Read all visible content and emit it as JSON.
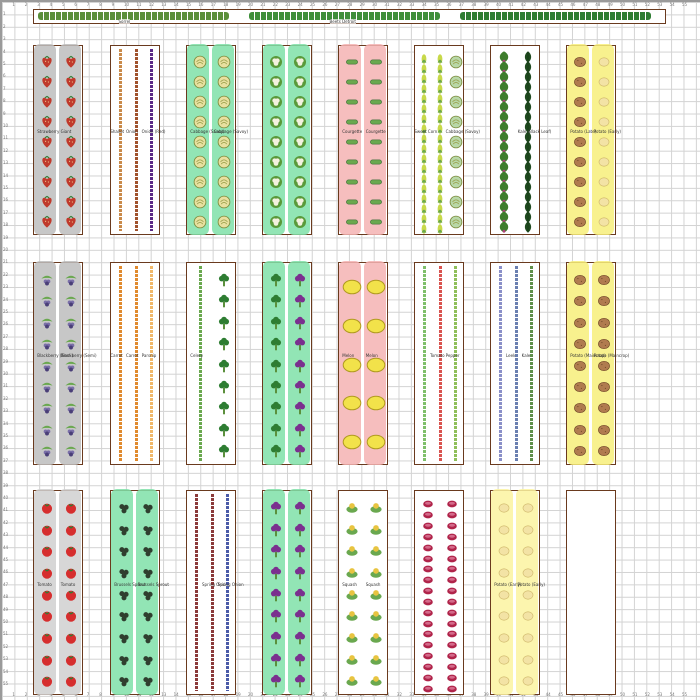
{
  "top_bed": {
    "segments": [
      {
        "label": "Sorrel",
        "color": "#5b8f3a",
        "kind": "leafy"
      },
      {
        "label": "Beets Detroit",
        "color": "#3f8f3a",
        "kind": "leafy"
      },
      {
        "label": "",
        "color": "#2e7d32",
        "kind": "onion"
      }
    ]
  },
  "beds": [
    {
      "row": 0,
      "col": 0,
      "highlight": "#bdbdbd",
      "cols": [
        {
          "label": "Strawberry Giant",
          "kind": "strawberry",
          "color": "#c0392b"
        },
        {
          "label": "",
          "kind": "strawberry",
          "color": "#c0392b"
        }
      ]
    },
    {
      "row": 0,
      "col": 1,
      "highlight": "",
      "cols": [
        {
          "label": "Shallot",
          "kind": "line",
          "color": "#c98a4a"
        },
        {
          "label": "Onion",
          "kind": "line",
          "color": "#a0522d"
        },
        {
          "label": "Onion (Red)",
          "kind": "line",
          "color": "#5b2a86"
        }
      ]
    },
    {
      "row": 0,
      "col": 2,
      "highlight": "#7fe0a8",
      "cols": [
        {
          "label": "Cabbage (Savoy)",
          "kind": "cabbage",
          "color": "#e8e0a0"
        },
        {
          "label": "Cabbage (Savoy)",
          "kind": "cabbage",
          "color": "#e8e0a0"
        }
      ]
    },
    {
      "row": 0,
      "col": 3,
      "highlight": "#7fe0a8",
      "cols": [
        {
          "label": "",
          "kind": "cauliflower",
          "color": "#f4f1e0"
        },
        {
          "label": "",
          "kind": "cauliflower",
          "color": "#f4f1e0"
        }
      ]
    },
    {
      "row": 0,
      "col": 4,
      "highlight": "#f5b3b3",
      "cols": [
        {
          "label": "Courgette",
          "kind": "zucchini",
          "color": "#6aa84f"
        },
        {
          "label": "Courgette",
          "kind": "zucchini",
          "color": "#6aa84f"
        }
      ]
    },
    {
      "row": 0,
      "col": 5,
      "highlight": "",
      "cols": [
        {
          "label": "Sweet Corn",
          "kind": "corn",
          "color": "#c8d94a"
        },
        {
          "label": "",
          "kind": "corn",
          "color": "#c8d94a"
        },
        {
          "label": "Cabbage (Savoy)",
          "kind": "cabbage",
          "color": "#b9d8a8"
        }
      ]
    },
    {
      "row": 0,
      "col": 6,
      "highlight": "",
      "cols": [
        {
          "label": "",
          "kind": "kale",
          "color": "#3e7d2c"
        },
        {
          "label": "Kale (Black Leaf)",
          "kind": "kale-dark",
          "color": "#1f4a1f"
        }
      ]
    },
    {
      "row": 0,
      "col": 7,
      "highlight": "#f7ef7a",
      "cols": [
        {
          "label": "Potato (Late)",
          "kind": "potato",
          "color": "#b07b4f"
        },
        {
          "label": "Potato (Early)",
          "kind": "potato-light",
          "color": "#f3e3a5"
        }
      ]
    },
    {
      "row": 1,
      "col": 0,
      "highlight": "#bdbdbd",
      "cols": [
        {
          "label": "Blackberry (Semi)",
          "kind": "blackberry",
          "color": "#7a6fa8"
        },
        {
          "label": "Blackberry (Semi)",
          "kind": "blackberry",
          "color": "#7a6fa8"
        }
      ]
    },
    {
      "row": 1,
      "col": 1,
      "highlight": "",
      "cols": [
        {
          "label": "Carrot",
          "kind": "line",
          "color": "#e08a2e"
        },
        {
          "label": "Carrot",
          "kind": "line",
          "color": "#e08a2e"
        },
        {
          "label": "Parsnip",
          "kind": "line",
          "color": "#f0b86a"
        }
      ]
    },
    {
      "row": 1,
      "col": 2,
      "highlight": "",
      "cols": [
        {
          "label": "Celery",
          "kind": "line",
          "color": "#6aa84f"
        },
        {
          "label": "",
          "kind": "broccoli",
          "color": "#2e7d32"
        }
      ]
    },
    {
      "row": 1,
      "col": 3,
      "highlight": "#7fe0a8",
      "cols": [
        {
          "label": "",
          "kind": "broccoli",
          "color": "#2e7d32"
        },
        {
          "label": "",
          "kind": "broccoli-purple",
          "color": "#7b2f8f"
        }
      ]
    },
    {
      "row": 1,
      "col": 4,
      "highlight": "#f5b3b3",
      "cols": [
        {
          "label": "Melon",
          "kind": "melon",
          "color": "#f2e24a"
        },
        {
          "label": "Melon",
          "kind": "melon",
          "color": "#f2e24a"
        }
      ]
    },
    {
      "row": 1,
      "col": 5,
      "highlight": "",
      "cols": [
        {
          "label": "",
          "kind": "line",
          "color": "#7fbf6a"
        },
        {
          "label": "Tomato",
          "kind": "line",
          "color": "#d9534f"
        },
        {
          "label": "Pepper",
          "kind": "line",
          "color": "#8fbf5a"
        }
      ]
    },
    {
      "row": 1,
      "col": 6,
      "highlight": "",
      "cols": [
        {
          "label": "",
          "kind": "line",
          "color": "#8a8fc8"
        },
        {
          "label": "Leek",
          "kind": "line",
          "color": "#6a7fb0"
        },
        {
          "label": "Kale",
          "kind": "line",
          "color": "#5f8f4a"
        }
      ]
    },
    {
      "row": 1,
      "col": 7,
      "highlight": "#f7ef7a",
      "cols": [
        {
          "label": "Potato (Maincrop)",
          "kind": "potato",
          "color": "#b07b4f"
        },
        {
          "label": "Potato (Maincrop)",
          "kind": "potato",
          "color": "#b07b4f"
        }
      ]
    },
    {
      "row": 2,
      "col": 0,
      "highlight": "#d0d0d0",
      "cols": [
        {
          "label": "Tomato",
          "kind": "tomato",
          "color": "#d62e2e"
        },
        {
          "label": "Tomato",
          "kind": "tomato",
          "color": "#d62e2e"
        }
      ]
    },
    {
      "row": 2,
      "col": 1,
      "highlight": "#7fe0a8",
      "cols": [
        {
          "label": "Brussels Sprout",
          "kind": "sprout",
          "color": "#2f3f2f"
        },
        {
          "label": "Brussels Sprout",
          "kind": "sprout",
          "color": "#2f3f2f"
        }
      ]
    },
    {
      "row": 2,
      "col": 2,
      "highlight": "",
      "cols": [
        {
          "label": "",
          "kind": "line",
          "color": "#8b3a3a"
        },
        {
          "label": "Spring Onion",
          "kind": "line",
          "color": "#8b3a3a"
        },
        {
          "label": "Spring Onion",
          "kind": "line",
          "color": "#4a5aa8"
        }
      ]
    },
    {
      "row": 2,
      "col": 3,
      "highlight": "#7fe0a8",
      "cols": [
        {
          "label": "",
          "kind": "broccoli-purple",
          "color": "#7b2f8f"
        },
        {
          "label": "",
          "kind": "broccoli-purple",
          "color": "#7b2f8f"
        }
      ]
    },
    {
      "row": 2,
      "col": 4,
      "highlight": "",
      "cols": [
        {
          "label": "Squash",
          "kind": "squash",
          "color": "#e8c440"
        },
        {
          "label": "Squash",
          "kind": "squash",
          "color": "#e8c440"
        }
      ]
    },
    {
      "row": 2,
      "col": 5,
      "highlight": "",
      "cols": [
        {
          "label": "",
          "kind": "radish",
          "color": "#b0244a"
        },
        {
          "label": "",
          "kind": "radish",
          "color": "#b0244a"
        }
      ]
    },
    {
      "row": 2,
      "col": 6,
      "highlight": "#fbf3a0",
      "cols": [
        {
          "label": "Potato (Early)",
          "kind": "potato-light",
          "color": "#f3e3a5"
        },
        {
          "label": "Potato (Early)",
          "kind": "potato-light",
          "color": "#f3e3a5"
        }
      ]
    },
    {
      "row": 2,
      "col": 7,
      "highlight": "",
      "cols": []
    }
  ]
}
